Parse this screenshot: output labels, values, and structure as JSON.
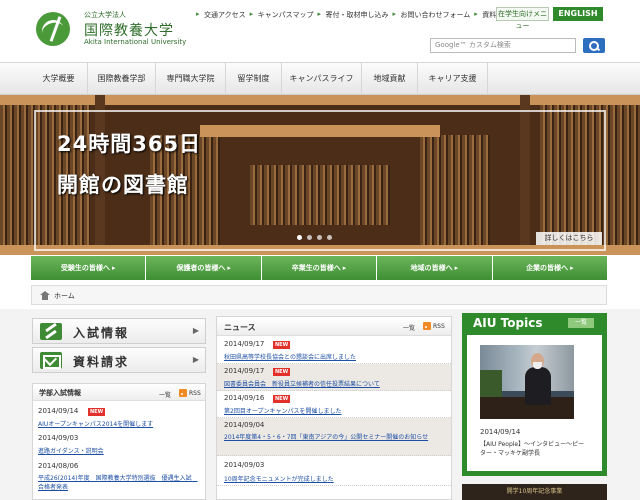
{
  "header": {
    "logo_sub": "公立大学法人",
    "logo_name": "国際教養大学",
    "logo_en": "Akita International University",
    "util_links": [
      "交通アクセス",
      "キャンパスマップ",
      "寄付・取材申し込み",
      "お問い合わせフォーム",
      "資料請求"
    ],
    "parent_btn": "在学生向けメニュー",
    "english_btn": "ENGLISH",
    "search_placeholder": "Google™ カスタム検索"
  },
  "nav": [
    "大学概要",
    "国際教養学部",
    "専門職大学院",
    "留学制度",
    "キャンパスライフ",
    "地域貢献",
    "キャリア支援"
  ],
  "hero": {
    "line1": "24時間365日",
    "line2": "開館の図書館",
    "more": "詳しくはこちら"
  },
  "audience": [
    "受験生の皆様へ",
    "保護者の皆様へ",
    "卒業生の皆様へ",
    "地域の皆様へ",
    "企業の皆様へ"
  ],
  "breadcrumb": {
    "home": "ホーム"
  },
  "quick": {
    "admission": "入試情報",
    "request": "資料請求"
  },
  "admissions": {
    "title": "学部入試情報",
    "list": "一覧",
    "rss": "RSS",
    "items": [
      {
        "date": "2014/09/14",
        "new": "NEW",
        "text": "AIUオープンキャンパス2014を開催します"
      },
      {
        "date": "2014/09/03",
        "new": "",
        "text": "進路ガイダンス・説明会"
      },
      {
        "date": "2014/08/06",
        "new": "",
        "text": "平成26(2014)年度　国際教養大学特別選抜　優遇生入試　合格者発表"
      }
    ]
  },
  "news": {
    "title": "ニュース",
    "list": "一覧",
    "rss": "RSS",
    "items": [
      {
        "date": "2014/09/17",
        "new": "NEW",
        "text": "秋田県高等学校長協会との懇談会に出席しました"
      },
      {
        "date": "2014/09/17",
        "new": "NEW",
        "text": "図書委員会員会　新役員立候補者の信任投票結果について"
      },
      {
        "date": "2014/09/16",
        "new": "NEW",
        "text": "第2回目オープンキャンパスを開催しました"
      },
      {
        "date": "2014/09/04",
        "new": "",
        "text": "2014年度第4・5・6・7回「東南アジアの今」公開セミナー開催のお知らせ"
      },
      {
        "date": "2014/09/03",
        "new": "",
        "text": "10周年記念モニュメントが完成しました"
      }
    ]
  },
  "topics": {
    "title": "AIU Topics",
    "more": "一覧",
    "date": "2014/09/14",
    "caption": "【AIU People】～インタビュー～ピーター・マッキケ副学長"
  },
  "anniv": "開学10周年記念事業"
}
